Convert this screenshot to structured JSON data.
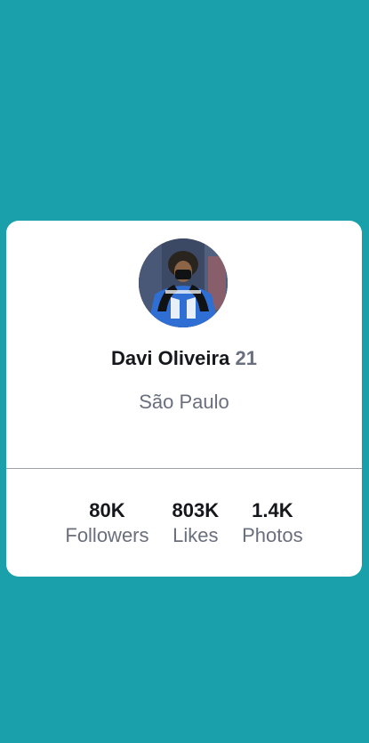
{
  "profile": {
    "name": "Davi Oliveira",
    "age": "21",
    "city": "São Paulo",
    "avatar_alt": "profile photo"
  },
  "stats": [
    {
      "value": "80K",
      "label": "Followers"
    },
    {
      "value": "803K",
      "label": "Likes"
    },
    {
      "value": "1.4K",
      "label": "Photos"
    }
  ],
  "colors": {
    "background": "#1aa0aa",
    "card": "#ffffff",
    "text_primary": "#15171c",
    "text_secondary": "#6a6f7e",
    "divider": "#9aa0a8"
  }
}
